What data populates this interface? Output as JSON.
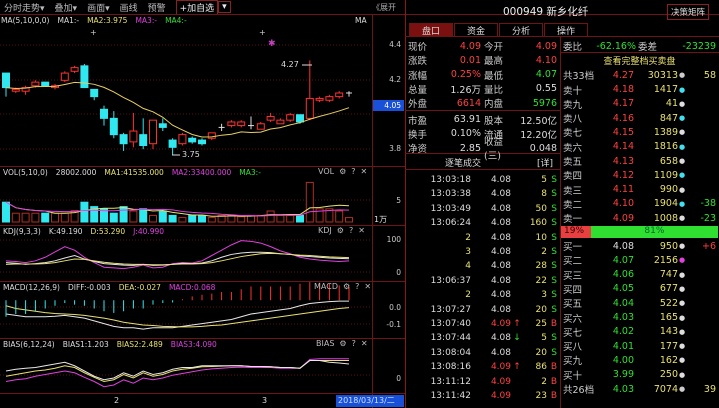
{
  "toolbar": {
    "items": [
      "分时走势▾",
      "叠加▾",
      "画面▾",
      "画线",
      "预警"
    ],
    "add_watch": "+加自选",
    "more": "▾",
    "expand": "《展开"
  },
  "main_legend": {
    "params": "MA(5,10,0,0)",
    "ma1": "MA1:-",
    "ma2": "MA2:3.975",
    "ma3": "MA3:-",
    "ma4": "MA4:-",
    "tag": "MA"
  },
  "main_axis": [
    "4.4",
    "4.2",
    "3.8"
  ],
  "current_price_tag": "4.05",
  "annotations": {
    "high": "4.27",
    "low": "3.75"
  },
  "vol_legend": {
    "params": "VOL(5,10,0)",
    "v": "28002.000",
    "ma1": "MA1:41535.000",
    "ma2": "MA2:33400.000",
    "ma3": "MA3:-",
    "tag": "VOL"
  },
  "vol_axis": [
    "5"
  ],
  "vol_unit": "1万",
  "kdj_legend": {
    "params": "KDJ(9,3,3)",
    "k": "K:49.190",
    "d": "D:53.290",
    "j": "J:40.990",
    "tag": "KDJ"
  },
  "kdj_axis": [
    "100",
    "0"
  ],
  "macd_legend": {
    "params": "MACD(12,26,9)",
    "diff": "DIFF:-0.003",
    "dea": "DEA:-0.027",
    "macd": "MACD:0.068",
    "tag": "MACD"
  },
  "macd_axis": [
    "0.0",
    "-0.1"
  ],
  "bias_legend": {
    "params": "BIAS(6,12,24)",
    "b1": "BIAS1:1.203",
    "b2": "BIAS2:2.489",
    "b3": "BIAS3:4.090",
    "tag": "BIAS"
  },
  "bias_axis": [
    "0"
  ],
  "panel_tools": {
    "gear": "⚙",
    "help": "?",
    "close": "✕"
  },
  "x_labels": [
    "2",
    "3"
  ],
  "date": "2018/03/13/二",
  "colors": {
    "up": "#ff3030",
    "down": "#30e8f0",
    "ma": "#e8d060",
    "white": "#e8e8e8",
    "yellow": "#e8e070",
    "magenta": "#e040e0",
    "grid": "#6e1414"
  },
  "chart_data": {
    "type": "candlestick",
    "candles": [
      [
        4.2,
        4.12,
        4.2,
        4.07
      ],
      [
        4.1,
        4.11,
        4.12,
        4.09
      ],
      [
        4.1,
        4.12,
        4.13,
        4.08
      ],
      [
        4.13,
        4.15,
        4.16,
        4.12
      ],
      [
        4.15,
        4.13,
        4.15,
        4.13
      ],
      [
        4.12,
        4.13,
        4.14,
        4.11
      ],
      [
        4.16,
        4.2,
        4.21,
        4.15
      ],
      [
        4.21,
        4.23,
        4.24,
        4.2
      ],
      [
        4.24,
        4.12,
        4.25,
        4.12
      ],
      [
        4.11,
        4.07,
        4.11,
        4.05
      ],
      [
        4.0,
        3.95,
        4.02,
        3.91
      ],
      [
        3.95,
        3.86,
        3.99,
        3.84
      ],
      [
        3.86,
        3.81,
        3.87,
        3.77
      ],
      [
        3.82,
        3.88,
        3.98,
        3.79
      ],
      [
        3.86,
        3.8,
        3.95,
        3.78
      ],
      [
        3.81,
        3.94,
        3.94,
        3.78
      ],
      [
        3.92,
        3.9,
        3.95,
        3.88
      ],
      [
        3.83,
        3.79,
        3.84,
        3.75
      ],
      [
        3.81,
        3.86,
        3.87,
        3.8
      ],
      [
        3.84,
        3.82,
        3.85,
        3.81
      ],
      [
        3.83,
        3.81,
        3.84,
        3.8
      ],
      [
        3.84,
        3.87,
        3.87,
        3.83
      ],
      [
        3.9,
        3.9,
        3.92,
        3.88
      ],
      [
        3.91,
        3.93,
        3.94,
        3.9
      ],
      [
        3.91,
        3.93,
        3.94,
        3.9
      ],
      [
        3.91,
        3.91,
        3.96,
        3.89
      ],
      [
        3.89,
        3.92,
        3.93,
        3.89
      ],
      [
        3.94,
        3.96,
        3.98,
        3.93
      ],
      [
        3.92,
        3.94,
        3.95,
        3.92
      ],
      [
        3.94,
        3.97,
        3.98,
        3.93
      ],
      [
        3.97,
        3.93,
        3.97,
        3.92
      ],
      [
        3.95,
        4.06,
        4.27,
        3.94
      ],
      [
        4.05,
        4.06,
        4.07,
        4.04
      ],
      [
        4.05,
        4.07,
        4.08,
        4.04
      ],
      [
        4.07,
        4.09,
        4.1,
        4.06
      ],
      [
        4.09,
        4.09,
        4.1,
        4.07
      ]
    ],
    "price_range": [
      3.72,
      4.46
    ],
    "volume": [
      4.5,
      2,
      2,
      2,
      2,
      2,
      2,
      2.6,
      4.5,
      3.5,
      3,
      2,
      3.5,
      2.5,
      3,
      1.5,
      2.5,
      1.5,
      1,
      1.5,
      1.5,
      1,
      1.5,
      1.5,
      1.2,
      1.5,
      1.5,
      2.5,
      1.5,
      1.5,
      1.5,
      9,
      3,
      3,
      2.5,
      1
    ],
    "volume_range": [
      0,
      10
    ],
    "kdj": {
      "k": [
        35,
        33,
        30,
        32,
        35,
        40,
        48,
        55,
        45,
        38,
        32,
        30,
        28,
        27,
        30,
        27,
        28,
        30,
        33,
        32,
        34,
        40,
        50,
        58,
        62,
        64,
        64,
        63,
        60,
        58,
        54,
        52,
        50,
        48,
        47,
        46
      ],
      "d": [
        30,
        31,
        31,
        31,
        32,
        35,
        40,
        45,
        44,
        40,
        36,
        33,
        31,
        30,
        30,
        29,
        29,
        30,
        31,
        31,
        32,
        35,
        40,
        46,
        52,
        56,
        60,
        61,
        60,
        58,
        56,
        55,
        53,
        51,
        50,
        49
      ],
      "j": [
        40,
        38,
        35,
        40,
        50,
        65,
        80,
        70,
        50,
        35,
        22,
        20,
        18,
        22,
        28,
        20,
        22,
        32,
        35,
        34,
        40,
        55,
        70,
        85,
        97,
        95,
        90,
        80,
        68,
        60,
        50,
        45,
        42,
        40,
        38,
        40
      ],
      "range": [
        0,
        110
      ]
    },
    "macd": {
      "dif": [
        -0.05,
        -0.055,
        -0.06,
        -0.06,
        -0.06,
        -0.058,
        -0.055,
        -0.06,
        -0.065,
        -0.075,
        -0.085,
        -0.095,
        -0.1,
        -0.1,
        -0.105,
        -0.1,
        -0.1,
        -0.1,
        -0.095,
        -0.09,
        -0.085,
        -0.08,
        -0.075,
        -0.07,
        -0.06,
        -0.05,
        -0.045,
        -0.04,
        -0.035,
        -0.03,
        -0.02,
        -0.012,
        -0.008,
        -0.005,
        -0.003,
        -0.003
      ],
      "dea": [
        -0.02,
        -0.03,
        -0.035,
        -0.04,
        -0.045,
        -0.048,
        -0.05,
        -0.052,
        -0.055,
        -0.06,
        -0.065,
        -0.072,
        -0.08,
        -0.085,
        -0.09,
        -0.092,
        -0.095,
        -0.096,
        -0.097,
        -0.097,
        -0.095,
        -0.092,
        -0.09,
        -0.085,
        -0.08,
        -0.075,
        -0.07,
        -0.065,
        -0.06,
        -0.055,
        -0.05,
        -0.045,
        -0.04,
        -0.035,
        -0.03,
        -0.027
      ],
      "range": [
        -0.13,
        0.03
      ]
    },
    "bias": {
      "b1": [
        3,
        3.5,
        3.8,
        4,
        4.5,
        5,
        5.5,
        4.5,
        3,
        1.5,
        0.5,
        1,
        2.5,
        1.5,
        3,
        2,
        2.5,
        3.5,
        4,
        4,
        4.5,
        4.5,
        4.5,
        4.5,
        4.5,
        4.3,
        4.3,
        4.2,
        4,
        4,
        3.8,
        6,
        6,
        5.5,
        5.3,
        5
      ],
      "b2": [
        1.5,
        2,
        2.5,
        3,
        3.3,
        3.8,
        4.5,
        4,
        2.5,
        1.2,
        0,
        0.5,
        2,
        1,
        2.5,
        1.5,
        2,
        3,
        3.5,
        3.8,
        4.2,
        4.3,
        4.4,
        4.5,
        4.5,
        4.3,
        4.3,
        4.2,
        4,
        4,
        3.8,
        6,
        6,
        6,
        6,
        6
      ],
      "b3": [
        0,
        0.5,
        0.8,
        1.5,
        2,
        2.5,
        3,
        2.5,
        1.2,
        0,
        -1.5,
        -1,
        0.5,
        -0.5,
        1,
        0.5,
        1,
        1.8,
        2.3,
        2.8,
        3.3,
        3.6,
        3.8,
        4,
        4.1,
        4,
        4,
        4,
        3.8,
        3.8,
        3.8,
        6.3,
        6.5,
        6.5,
        6.5,
        6.5
      ],
      "range": [
        -3,
        9
      ]
    }
  },
  "quote": {
    "title": "000949 新乡化纤",
    "matrix_btn": "决策矩阵",
    "tabs": [
      "盘口",
      "资金",
      "分析",
      "操作"
    ],
    "rows": [
      [
        "现价",
        "4.09",
        "今开",
        "4.09"
      ],
      [
        "涨跌",
        "0.01",
        "最高",
        "4.10"
      ],
      [
        "涨幅",
        "0.25%",
        "最低",
        "4.07"
      ],
      [
        "总量",
        "1.26万",
        "量比",
        "0.55"
      ],
      [
        "外盘",
        "6614",
        "内盘",
        "5976"
      ],
      [
        "市盈",
        "63.91",
        "股本",
        "12.50亿"
      ],
      [
        "换手",
        "0.10%",
        "流通",
        "12.20亿"
      ],
      [
        "净资",
        "2.85",
        "收益(三)",
        "0.048"
      ]
    ]
  },
  "orderbook": {
    "wb_label": "委比",
    "wb": "-62.16%",
    "wc_label": "委差",
    "wc": "-23239",
    "full_link": "查看完整档买卖盘",
    "sell_total": [
      "共33档",
      "4.27",
      "30313",
      "58"
    ],
    "sells": [
      [
        "卖十",
        "4.18",
        "1417",
        ""
      ],
      [
        "卖九",
        "4.17",
        "41",
        ""
      ],
      [
        "卖八",
        "4.16",
        "847",
        ""
      ],
      [
        "卖七",
        "4.15",
        "1389",
        ""
      ],
      [
        "卖六",
        "4.14",
        "1816",
        ""
      ],
      [
        "卖五",
        "4.13",
        "658",
        ""
      ],
      [
        "卖四",
        "4.12",
        "1109",
        ""
      ],
      [
        "卖三",
        "4.11",
        "990",
        ""
      ],
      [
        "卖二",
        "4.10",
        "1904",
        "-38"
      ],
      [
        "卖一",
        "4.09",
        "1008",
        "-23"
      ]
    ],
    "ratio_sell": "19%",
    "ratio_buy": "81%",
    "ratio_value": 0.19,
    "buys": [
      [
        "买一",
        "4.08",
        "950",
        "+6"
      ],
      [
        "买二",
        "4.07",
        "2156",
        ""
      ],
      [
        "买三",
        "4.06",
        "747",
        ""
      ],
      [
        "买四",
        "4.05",
        "677",
        ""
      ],
      [
        "买五",
        "4.04",
        "522",
        ""
      ],
      [
        "买六",
        "4.03",
        "165",
        ""
      ],
      [
        "买七",
        "4.02",
        "143",
        ""
      ],
      [
        "买八",
        "4.01",
        "177",
        ""
      ],
      [
        "买九",
        "4.00",
        "162",
        ""
      ],
      [
        "买十",
        "3.99",
        "250",
        ""
      ]
    ],
    "buy_total": [
      "共26档",
      "4.03",
      "7074",
      "39"
    ]
  },
  "trades": {
    "title": "逐笔成交",
    "detail": "[详]",
    "rows": [
      [
        "13:03:18",
        "4.08",
        "",
        "5",
        "S"
      ],
      [
        "13:03:38",
        "4.08",
        "",
        "8",
        "S"
      ],
      [
        "13:03:49",
        "4.08",
        "",
        "50",
        "S"
      ],
      [
        "13:06:24",
        "4.08",
        "",
        "160",
        "S"
      ],
      [
        "2",
        "4.08",
        "",
        "10",
        "S"
      ],
      [
        "3",
        "4.08",
        "",
        "2",
        "S"
      ],
      [
        "4",
        "4.08",
        "",
        "28",
        "S"
      ],
      [
        "13:06:37",
        "4.08",
        "",
        "22",
        "S"
      ],
      [
        "2",
        "4.08",
        "",
        "3",
        "S"
      ],
      [
        "13:07:27",
        "4.08",
        "",
        "20",
        "S"
      ],
      [
        "13:07:40",
        "4.09",
        "↑",
        "25",
        "B"
      ],
      [
        "13:07:44",
        "4.08",
        "↓",
        "5",
        "S"
      ],
      [
        "13:08:04",
        "4.08",
        "",
        "20",
        "S"
      ],
      [
        "13:08:16",
        "4.09",
        "↑",
        "86",
        "B"
      ],
      [
        "13:11:12",
        "4.09",
        "",
        "2",
        "B"
      ],
      [
        "13:11:42",
        "4.09",
        "",
        "23",
        "B"
      ]
    ]
  }
}
